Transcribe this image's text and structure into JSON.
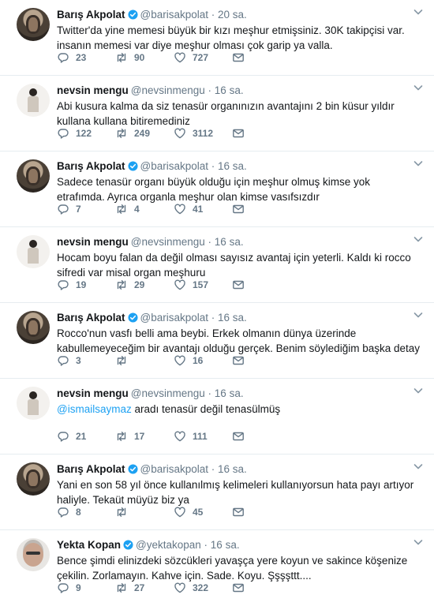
{
  "tweets": [
    {
      "name": "Barış Akpolat",
      "handle": "@barisakpolat",
      "time": "20 sa.",
      "verified": true,
      "avatar": "baris",
      "text": "Twitter'da yine memesi büyük bir kızı meşhur etmişsiniz. 30K takipçisi var. insanın memesi var diye meşhur olması çok garip ya valla.",
      "replies": "23",
      "retweets": "90",
      "likes": "727"
    },
    {
      "name": "nevsin mengu",
      "handle": "@nevsinmengu",
      "time": "16 sa.",
      "verified": false,
      "avatar": "nevsin",
      "text": "Abi kusura kalma da siz tenasür organınızın avantajını 2 bin küsur yıldır kullana kullana bitiremediniz",
      "replies": "122",
      "retweets": "249",
      "likes": "3112"
    },
    {
      "name": "Barış Akpolat",
      "handle": "@barisakpolat",
      "time": "16 sa.",
      "verified": true,
      "avatar": "baris",
      "text": "Sadece tenasür organı büyük olduğu için meşhur olmuş kimse yok etrafımda. Ayrıca organla meşhur olan kimse vasıfsızdır",
      "replies": "7",
      "retweets": "4",
      "likes": "41"
    },
    {
      "name": "nevsin mengu",
      "handle": "@nevsinmengu",
      "time": "16 sa.",
      "verified": false,
      "avatar": "nevsin",
      "text": "Hocam boyu falan da değil olması sayısız avantaj için yeterli. Kaldı ki rocco sifredi var misal organ meşhuru",
      "replies": "19",
      "retweets": "29",
      "likes": "157"
    },
    {
      "name": "Barış Akpolat",
      "handle": "@barisakpolat",
      "time": "16 sa.",
      "verified": true,
      "avatar": "baris",
      "text": "Rocco'nun vasfı belli ama beybi. Erkek olmanın dünya üzerinde kabullemeyeceğim bir avantajı olduğu gerçek. Benim söylediğim başka detay",
      "replies": "3",
      "retweets": "",
      "likes": "16"
    },
    {
      "name": "nevsin mengu",
      "handle": "@nevsinmengu",
      "time": "16 sa.",
      "verified": false,
      "avatar": "nevsin",
      "mention": "@ismailsaymaz",
      "text": " aradı tenasür değil tenasülmüş",
      "replies": "21",
      "retweets": "17",
      "likes": "111"
    },
    {
      "name": "Barış Akpolat",
      "handle": "@barisakpolat",
      "time": "16 sa.",
      "verified": true,
      "avatar": "baris",
      "text": "Yani en son 58 yıl önce kullanılmış kelimeleri kullanıyorsun hata payı artıyor haliyle. Tekaüt müyüz biz ya",
      "replies": "8",
      "retweets": "",
      "likes": "45"
    },
    {
      "name": "Yekta Kopan",
      "handle": "@yektakopan",
      "time": "16 sa.",
      "verified": true,
      "avatar": "yekta",
      "text": "Bence şimdi elinizdeki sözcükleri yavaşça yere koyun ve sakince köşenize çekilin. Zorlamayın. Kahve için. Sade. Koyu. Şşşşttt....",
      "replies": "9",
      "retweets": "27",
      "likes": "322"
    }
  ],
  "colors": {
    "accent": "#1da1f2",
    "muted": "#657786",
    "text": "#14171a",
    "divider": "#e6ecf0"
  },
  "icons": {
    "reply": "reply-icon",
    "retweet": "retweet-icon",
    "like": "heart-icon",
    "dm": "envelope-icon",
    "more": "chevron-down-icon",
    "verified": "verified-badge-icon"
  }
}
